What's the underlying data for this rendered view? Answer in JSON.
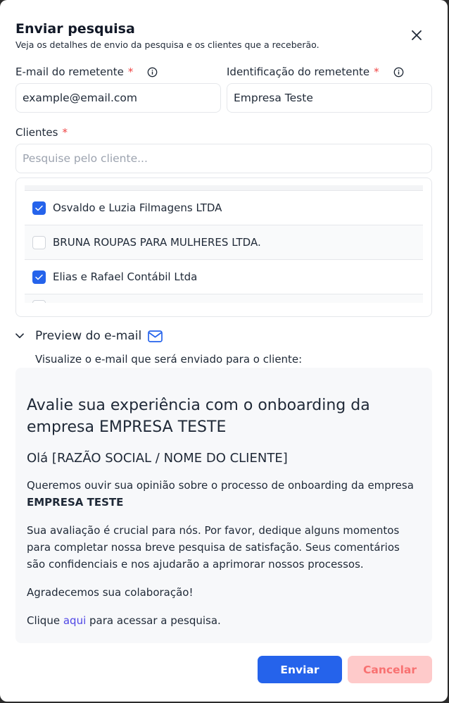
{
  "dialog": {
    "title": "Enviar pesquisa",
    "subtitle": "Veja os detalhes de envio da pesquisa e os clientes que a receberão."
  },
  "sender_email": {
    "label": "E-mail do remetente",
    "required_mark": "*",
    "value": "example@email.com"
  },
  "sender_id": {
    "label": "Identificação do remetente",
    "required_mark": "*",
    "value": "Empresa Teste"
  },
  "clients": {
    "label": "Clientes",
    "required_mark": "*",
    "search_placeholder": "Pesquise pelo cliente...",
    "items": [
      {
        "name": "Osvaldo e Luzia Filmagens LTDA",
        "checked": true
      },
      {
        "name": "BRUNA ROUPAS PARA MULHERES LTDA.",
        "checked": false
      },
      {
        "name": "Elias e Rafael Contábil Ltda",
        "checked": true
      }
    ]
  },
  "preview": {
    "toggle_label": "Preview do e-mail",
    "description": "Visualize o e-mail que será enviado para o cliente:",
    "email": {
      "title": "Avalie sua experiência com o onboarding da empresa EMPRESA TESTE",
      "greeting": "Olá [RAZÃO SOCIAL / NOME DO CLIENTE]",
      "p1_text": "Queremos ouvir sua opinião sobre o processo de onboarding da empresa",
      "p1_company": "EMPRESA TESTE",
      "p2": "Sua avaliação é crucial para nós. Por favor, dedique alguns momentos para completar nossa breve pesquisa de satisfação. Seus comentários são confidenciais e nos ajudarão a aprimorar nossos processos.",
      "p3": "Agradecemos sua colaboração!",
      "p4_before": "Clique",
      "p4_link": "aqui",
      "p4_after": "para acessar a pesquisa."
    }
  },
  "actions": {
    "send_label": "Enviar",
    "cancel_label": "Cancelar"
  },
  "colors": {
    "primary": "#2563eb",
    "danger_soft": "#fecaca",
    "danger_text": "#f87171",
    "required": "#ef4444",
    "link": "#4f46e5"
  }
}
